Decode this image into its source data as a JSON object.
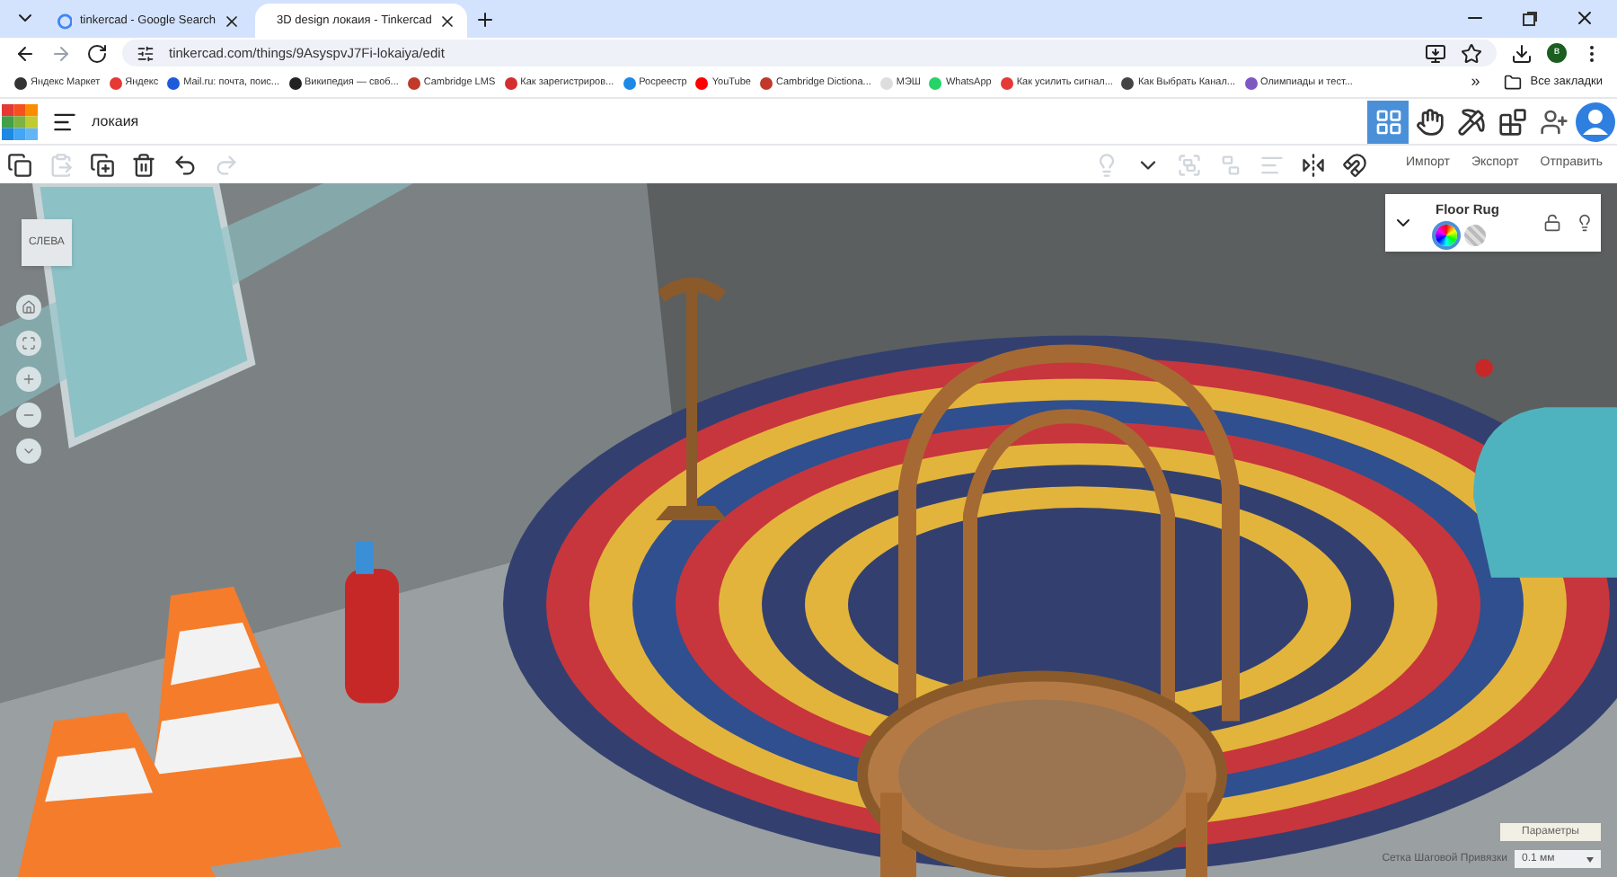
{
  "browser": {
    "tabs": [
      {
        "title": "tinkercad - Google Search",
        "kind": "google",
        "selected": false
      },
      {
        "title": "3D design локаия - Tinkercad",
        "kind": "tinkercad",
        "selected": true
      }
    ],
    "url": "tinkercad.com/things/9AsyspvJ7Fi-lokaiya/edit",
    "profile_initial": "в",
    "bookmarks": [
      {
        "title": "Яндекс Маркет",
        "color": "#333333"
      },
      {
        "title": "Яндекс",
        "color": "#e53935"
      },
      {
        "title": "Mail.ru: почта, поис...",
        "color": "#1e5bd8"
      },
      {
        "title": "Википедия — своб...",
        "color": "#222222"
      },
      {
        "title": "Cambridge LMS",
        "color": "#c0392b"
      },
      {
        "title": "Как зарегистриров...",
        "color": "#d32f2f"
      },
      {
        "title": "Росреестр",
        "color": "#1e88e5"
      },
      {
        "title": "YouTube",
        "color": "#ff0000"
      },
      {
        "title": "Cambridge Dictiona...",
        "color": "#c0392b"
      },
      {
        "title": "МЭШ",
        "color": "#dddddd"
      },
      {
        "title": "WhatsApp",
        "color": "#25d366"
      },
      {
        "title": "Как усилить сигнал...",
        "color": "#e53935"
      },
      {
        "title": "Как Выбрать Канал...",
        "color": "#444444"
      },
      {
        "title": "Олимпиады и тест...",
        "color": "#7e57c2"
      }
    ],
    "more_bookmarks": "»",
    "all_bookmarks": "Все закладки"
  },
  "app": {
    "project_name": "локаия",
    "header_tools": [
      {
        "kind": "grid",
        "selected": true
      },
      {
        "kind": "hand",
        "selected": false
      },
      {
        "kind": "pickaxe",
        "selected": false
      },
      {
        "kind": "bricks",
        "selected": false
      }
    ],
    "edit_tools": [
      {
        "kind": "copy",
        "disabled": false
      },
      {
        "kind": "paste",
        "disabled": true
      },
      {
        "kind": "duplicate",
        "disabled": false
      },
      {
        "kind": "delete",
        "disabled": false
      },
      {
        "kind": "undo",
        "disabled": false
      },
      {
        "kind": "redo",
        "disabled": true
      }
    ],
    "shape_tools": [
      {
        "kind": "light",
        "disabled": true
      },
      {
        "kind": "dropdown",
        "disabled": false
      },
      {
        "kind": "group",
        "disabled": true
      },
      {
        "kind": "ungroup",
        "disabled": true
      },
      {
        "kind": "align",
        "disabled": true
      },
      {
        "kind": "mirror",
        "disabled": false
      },
      {
        "kind": "magnet",
        "disabled": false
      }
    ],
    "actions": [
      "Импорт",
      "Экспорт",
      "Отправить"
    ],
    "view_cube": "СЛЕВА",
    "inspector": {
      "title": "Floor Rug",
      "expanded": true,
      "options": [
        {
          "kind": "solid",
          "selected": true
        },
        {
          "kind": "hole",
          "selected": false
        }
      ],
      "locked": false
    },
    "settings_button": "Параметры",
    "snap_label": "Сетка Шаговой Привязки",
    "snap_value": "0.1 мм"
  }
}
